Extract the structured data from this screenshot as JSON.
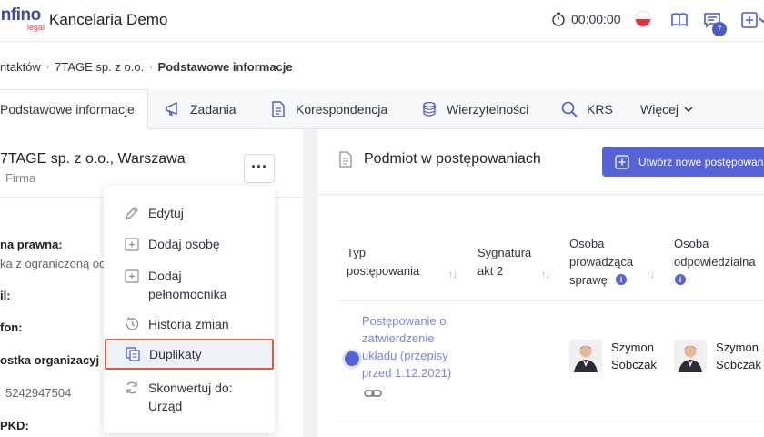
{
  "app": {
    "logo_main": "infino",
    "logo_sub": "legal",
    "title": "Kancelaria Demo",
    "timer": "00:00:00",
    "notifications_count": "7"
  },
  "breadcrumb": {
    "items": [
      "ntaktów",
      "7TAGE sp. z o.o.",
      "Podstawowe informacje"
    ]
  },
  "tabs": [
    {
      "label": "Podstawowe informacje",
      "icon": "none"
    },
    {
      "label": "Zadania",
      "icon": "megaphone-icon"
    },
    {
      "label": "Korespondencja",
      "icon": "document-icon"
    },
    {
      "label": "Wierzytelności",
      "icon": "coins-icon"
    },
    {
      "label": "KRS",
      "icon": "search-icon"
    },
    {
      "label": "Więcej",
      "icon": "chevron-down-icon"
    }
  ],
  "left": {
    "company_name": "7TAGE sp. z o.o., Warszawa",
    "company_type": "Firma",
    "more": "···",
    "fields": {
      "legal_form_label": "na prawna:",
      "legal_form_value": "ka z ograniczoną od",
      "email_label": "il:",
      "phone_label": "fon:",
      "unit_label": "ostka organizacyj",
      "nip_value": "5242947504",
      "pkd_label": "PKD:"
    }
  },
  "menu": {
    "items": [
      {
        "label": "Edytuj",
        "icon": "pencil-icon"
      },
      {
        "label": "Dodaj osobę",
        "icon": "add-box-icon"
      },
      {
        "label": "Dodaj\npełnomocnika",
        "icon": "add-box-icon"
      },
      {
        "label": "Historia zmian",
        "icon": "history-icon"
      },
      {
        "label": "Duplikaty",
        "icon": "duplicate-icon"
      },
      {
        "label": "Skonwertuj do:\nUrząd",
        "icon": "convert-icon"
      }
    ]
  },
  "right": {
    "title": "Podmiot w postępowaniach",
    "create_button": "Utwórz nowe postępowanie",
    "columns": [
      {
        "label": "Typ\npostępowania"
      },
      {
        "label": "Sygnatura\nakt 2"
      },
      {
        "label": "Osoba\nprowadząca\nsprawę"
      },
      {
        "label": "Osoba\nodpowiedzialna"
      }
    ],
    "row": {
      "case_type": "Postępowanie o zatwierdzenie układu (przepisy przed 1.12.2021)",
      "lead_person": "Szymon\nSobczak",
      "responsible_person": "Szymon\nSobczak"
    }
  },
  "colors": {
    "accent": "#5563d6",
    "link": "#7a86d8",
    "highlight_border": "#e05a3a",
    "badge": "#4a5ac8"
  }
}
